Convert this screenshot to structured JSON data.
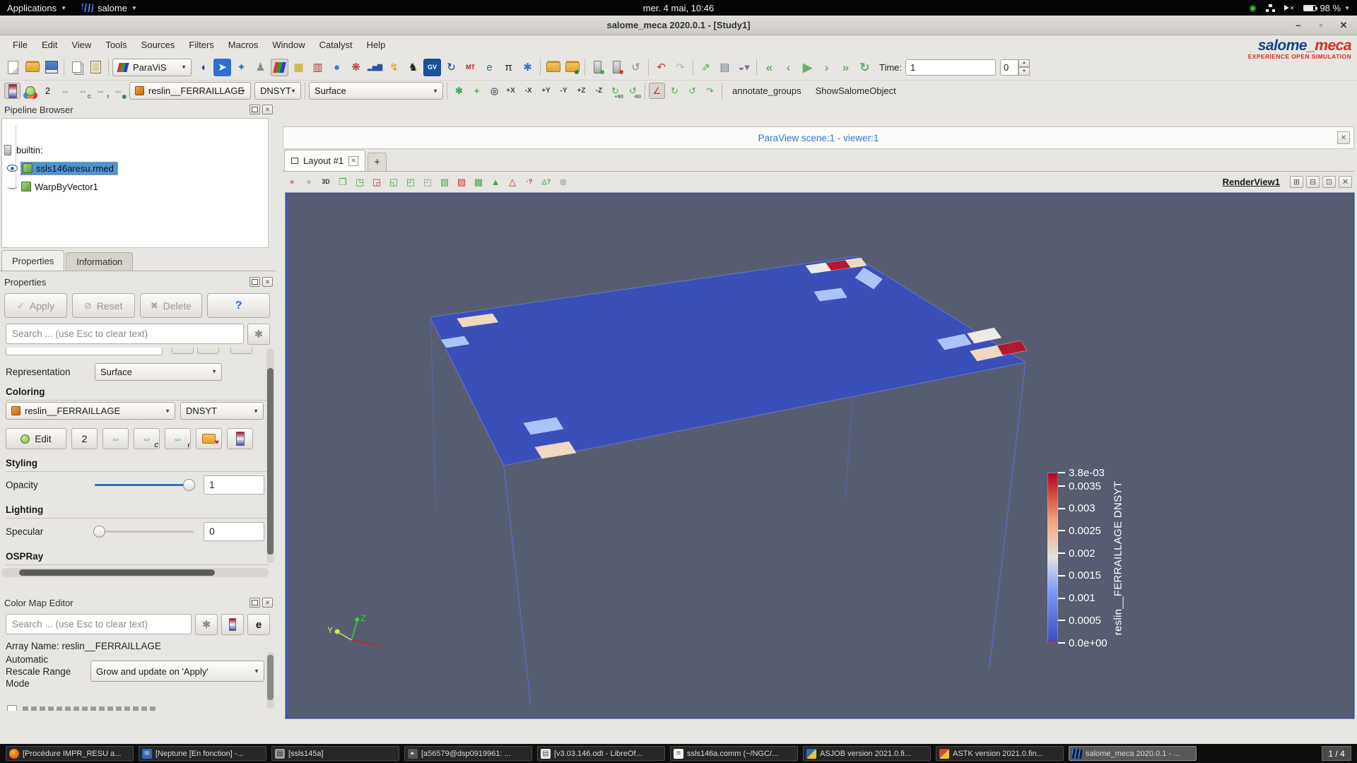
{
  "system_bar": {
    "applications_label": "Applications",
    "app_label": "salome",
    "clock": "mer.  4 mai, 10:46",
    "battery_label": "98 %"
  },
  "window": {
    "title": "salome_meca 2020.0.1 - [Study1]"
  },
  "menu_bar": {
    "items": [
      "File",
      "Edit",
      "View",
      "Tools",
      "Sources",
      "Filters",
      "Macros",
      "Window",
      "Catalyst",
      "Help"
    ]
  },
  "brand": {
    "title_blue": "salome",
    "title_red": "_meca",
    "tagline": "EXPERIENCE OPEN SIMULATION"
  },
  "toolbar1": {
    "module_selector": "ParaViS",
    "time_label": "Time:",
    "time_value": "1",
    "frame_value": "0",
    "file_icons": [
      {
        "name": "new-document-icon",
        "cls": "icp"
      },
      {
        "name": "open-file-icon",
        "cls": "icf"
      },
      {
        "name": "save-study-icon",
        "cls": "icfl"
      }
    ],
    "edit_icons": [
      {
        "name": "copy-icon",
        "cls": "iccp"
      },
      {
        "name": "paste-icon",
        "cls": "icpb"
      }
    ],
    "module_icons": [
      {
        "name": "shaper-module-icon",
        "glyph": "◖",
        "color": "#16418c"
      },
      {
        "name": "geometry-module-icon",
        "glyph": "➤",
        "color": "#ffffff",
        "bg": "#2f6fd0"
      },
      {
        "name": "mesh-module-icon",
        "glyph": "✦",
        "color": "#2a7ab5"
      },
      {
        "name": "smesh-tools-icon",
        "glyph": "♟",
        "color": "#8a8a8a"
      },
      {
        "name": "paravis-module-icon",
        "cls": "rgb",
        "pressed": true
      },
      {
        "name": "yacs-module-icon",
        "glyph": "▦",
        "color": "#c8a400"
      },
      {
        "name": "jobmanager-module-icon",
        "glyph": "▥",
        "color": "#b03030"
      },
      {
        "name": "med-module-icon",
        "glyph": "●",
        "color": "#3a7bd5"
      },
      {
        "name": "adao-module-icon",
        "glyph": "❋",
        "color": "#c02020"
      },
      {
        "name": "plot-module-icon",
        "glyph": "▂▅▇",
        "color": "#2255aa",
        "cls": "sm"
      },
      {
        "name": "ma-module-icon",
        "glyph": "↯",
        "color": "#d8a400"
      },
      {
        "name": "asterstudy-module-icon",
        "glyph": "♞",
        "color": "#222222"
      },
      {
        "name": "eficas-module-icon",
        "glyph": "GV",
        "cls": "sm",
        "color": "#ffffff",
        "bg": "#1a4f9c"
      },
      {
        "name": "curve-module-icon",
        "glyph": "↻",
        "color": "#16418c"
      },
      {
        "name": "mt-module-icon",
        "glyph": "MT",
        "cls": "sm",
        "color": "#c01818"
      },
      {
        "name": "europlexus-module-icon",
        "glyph": "e",
        "color": "#11808a"
      },
      {
        "name": "pi-module-icon",
        "glyph": "π",
        "color": "#222222"
      },
      {
        "name": "settings-gear-icon",
        "glyph": "✱",
        "color": "#3a6fd0"
      }
    ],
    "open_icons": [
      {
        "name": "open-data-file-icon",
        "cls": "icf"
      },
      {
        "name": "load-state-icon",
        "cls": "icf",
        "dot": "#2a8a2a"
      }
    ],
    "server_icons": [
      {
        "name": "connect-server-icon",
        "cls": "icsv",
        "dot": "#3fae3f"
      },
      {
        "name": "disconnect-server-icon",
        "cls": "icsv",
        "dot": "#d04040"
      },
      {
        "name": "reset-session-icon",
        "glyph": "↺",
        "color": "#8a8a8a"
      }
    ],
    "history_icons": [
      {
        "name": "undo-icon",
        "glyph": "↶",
        "color": "#c03a2b"
      },
      {
        "name": "redo-icon",
        "glyph": "↷",
        "color": "#b5b5b5"
      }
    ],
    "capture_icons": [
      {
        "name": "export-scene-icon",
        "glyph": "⇗",
        "color": "#3fae3f"
      },
      {
        "name": "capture-screenshot-icon",
        "glyph": "▤",
        "color": "#667788"
      },
      {
        "name": "color-palette-icon",
        "glyph": "◒▾",
        "color": "#8a6ab0"
      }
    ],
    "playback_icons": [
      {
        "name": "first-frame-icon",
        "glyph": "«",
        "color": "#6fae6f"
      },
      {
        "name": "previous-frame-icon",
        "glyph": "‹",
        "color": "#6fae6f"
      },
      {
        "name": "play-icon",
        "glyph": "▶",
        "color": "#6fae6f"
      },
      {
        "name": "next-frame-icon",
        "glyph": "›",
        "color": "#6fae6f"
      },
      {
        "name": "last-frame-icon",
        "glyph": "»",
        "color": "#6fae6f"
      },
      {
        "name": "loop-icon",
        "glyph": "↻",
        "color": "#6fae6f"
      }
    ]
  },
  "toolbar2": {
    "array_name": "reslin__FERRAILLAGE",
    "component": "DNSYT",
    "representation": "Surface",
    "left_icons": [
      {
        "name": "toggle-color-legend-icon",
        "cls": "iccm",
        "pressed": true
      },
      {
        "name": "edit-color-map-icon",
        "cls": "icbl"
      },
      {
        "name": "set-solid-color-icon",
        "glyph": "2",
        "color": "#111111"
      },
      {
        "name": "rescale-to-data-range-icon",
        "glyph": "⇔",
        "color": "#4aae4a"
      },
      {
        "name": "rescale-to-custom-range-icon",
        "glyph": "⇔",
        "sub": "C",
        "color": "#4aae4a"
      },
      {
        "name": "rescale-over-time-icon",
        "glyph": "⇔",
        "sub": "t",
        "color": "#4aae4a"
      },
      {
        "name": "rescale-to-visible-icon",
        "glyph": "⇔",
        "sub": "◉",
        "color": "#4aae4a"
      }
    ],
    "camera_icons": [
      {
        "name": "reset-camera-icon",
        "glyph": "✱",
        "color": "#4aae4a"
      },
      {
        "name": "zoom-to-data-icon",
        "glyph": "+",
        "color": "#4aae4a"
      },
      {
        "name": "zoom-to-box-icon",
        "glyph": "◎",
        "color": "#556677"
      }
    ],
    "view_buttons": [
      {
        "name": "view-plus-x-icon",
        "label": "+X"
      },
      {
        "name": "view-minus-x-icon",
        "label": "-X"
      },
      {
        "name": "view-plus-y-icon",
        "label": "+Y"
      },
      {
        "name": "view-minus-y-icon",
        "label": "-Y"
      },
      {
        "name": "view-plus-z-icon",
        "label": "+Z"
      },
      {
        "name": "view-minus-z-icon",
        "label": "-Z"
      }
    ],
    "rotate_buttons": [
      {
        "name": "rotate-90-cw-icon",
        "glyph": "↻",
        "sub": "+90",
        "color": "#4aae4a"
      },
      {
        "name": "rotate-90-ccw-icon",
        "glyph": "↺",
        "sub": "-90",
        "color": "#4aae4a"
      }
    ],
    "axes_icons": [
      {
        "name": "show-orientation-axes-icon",
        "glyph": "∠",
        "color": "#cc3333",
        "pressed": true
      },
      {
        "name": "rotate-view-cw-icon",
        "glyph": "↻",
        "color": "#4aae4a"
      },
      {
        "name": "rotate-view-ccw-icon",
        "glyph": "↺",
        "color": "#4aae4a"
      },
      {
        "name": "pick-rotation-center-icon",
        "glyph": "↷",
        "color": "#4aae4a"
      }
    ],
    "macros": [
      {
        "name": "macro-annotate-groups",
        "label": "annotate_groups"
      },
      {
        "name": "macro-show-salome-object",
        "label": "ShowSalomeObject"
      }
    ]
  },
  "pipeline": {
    "title": "Pipeline Browser",
    "items": [
      {
        "label": "builtin:"
      },
      {
        "label": "ssls146aresu.rmed"
      },
      {
        "label": "WarpByVector1"
      }
    ]
  },
  "properties_panel": {
    "tabs": [
      {
        "label": "Properties",
        "active": true
      },
      {
        "label": "Information"
      }
    ],
    "dock_title": "Properties",
    "apply_label": "Apply",
    "reset_label": "Reset",
    "delete_label": "Delete",
    "help_label": "?",
    "search_placeholder": "Search ... (use Esc to clear text)",
    "representation_label": "Representation",
    "representation_value": "Surface",
    "coloring_title": "Coloring",
    "coloring_array": "reslin__FERRAILLAGE",
    "coloring_component": "DNSYT",
    "edit_label": "Edit",
    "coloring_icons": [
      {
        "name": "edit-color-map-2-icon",
        "glyph": "2",
        "color": "#111111"
      },
      {
        "name": "rescale-to-data-range-icon",
        "glyph": "⇔",
        "color": "#4aae4a"
      },
      {
        "name": "rescale-to-custom-range-icon",
        "glyph": "⇔",
        "sub": "C",
        "color": "#4aae4a"
      },
      {
        "name": "rescale-over-time-icon",
        "glyph": "⇔",
        "sub": "t",
        "color": "#4aae4a"
      },
      {
        "name": "choose-preset-icon",
        "cls": "icfh"
      },
      {
        "name": "show-color-legend-icon",
        "cls": "iccm"
      }
    ],
    "styling_title": "Styling",
    "opacity_label": "Opacity",
    "opacity_value": "1",
    "lighting_title": "Lighting",
    "specular_label": "Specular",
    "specular_value": "0",
    "ospray_title": "OSPRay"
  },
  "color_map_editor": {
    "title": "Color Map Editor",
    "search_placeholder": "Search ... (use Esc to clear text)",
    "array_name": "Array Name: reslin__FERRAILLAGE",
    "rescale_mode_label": [
      "Automatic",
      "Rescale Range",
      "Mode"
    ],
    "rescale_mode_value": "Grow and update on 'Apply'"
  },
  "viewer": {
    "scene_title": "ParaView scene:1 - viewer:1",
    "layout_tab": "Layout #1",
    "view_label": "RenderView1",
    "axes": {
      "x": "x",
      "y": "Y",
      "z": "Z"
    },
    "toolbar_icons": [
      {
        "name": "edit-camera-icon",
        "glyph": "⌖",
        "color": "#c0392b"
      },
      {
        "name": "adjust-camera-icon",
        "glyph": "⌖",
        "color": "#999999"
      },
      {
        "name": "interaction-mode-3d-icon",
        "glyph": "3D",
        "cls": "sm",
        "color": "#333333"
      },
      {
        "name": "zoom-closest-icon",
        "glyph": "❒",
        "color": "#3fae3f"
      },
      {
        "name": "zoom-in-rect-icon",
        "glyph": "◳",
        "color": "#3fae3f"
      },
      {
        "name": "zoom-out-rect-icon",
        "glyph": "◲",
        "color": "#c0392b"
      },
      {
        "name": "zoom-box-icon",
        "glyph": "◱",
        "color": "#3fae3f"
      },
      {
        "name": "select-cells-rect-icon",
        "glyph": "◰",
        "color": "#3fae3f"
      },
      {
        "name": "select-points-rect-icon",
        "glyph": "◰",
        "color": "#999999"
      },
      {
        "name": "select-cells-polygon-icon",
        "glyph": "▧",
        "color": "#3fae3f"
      },
      {
        "name": "select-points-polygon-icon",
        "glyph": "▨",
        "color": "#c0392b"
      },
      {
        "name": "select-block-icon",
        "glyph": "▩",
        "color": "#3fae3f"
      },
      {
        "name": "interactive-select-cells-icon",
        "glyph": "▲",
        "color": "#3fae3f"
      },
      {
        "name": "interactive-select-points-icon",
        "glyph": "△",
        "color": "#c0392b"
      },
      {
        "name": "hover-points-icon",
        "glyph": "·?",
        "cls": "sm",
        "color": "#c0392b"
      },
      {
        "name": "hover-cells-icon",
        "glyph": "△?",
        "cls": "sm",
        "color": "#3fae3f"
      },
      {
        "name": "clear-selection-icon",
        "glyph": "⊗",
        "color": "#999999"
      }
    ]
  },
  "chart_data": {
    "type": "colorbar-legend",
    "title": "reslin__FERRAILLAGE DNSYT",
    "min": 0,
    "max": 0.0038,
    "tick_values": [
      0.0038,
      0.0035,
      0.003,
      0.0025,
      0.002,
      0.0015,
      0.001,
      0.0005,
      0
    ],
    "tick_labels": [
      "3.8e-03",
      "0.0035",
      "0.003",
      "0.0025",
      "0.002",
      "0.0015",
      "0.001",
      "0.0005",
      "0.0e+00"
    ],
    "colormap": "cool-warm",
    "colors": {
      "min": "#3b4cc0",
      "mid": "#f1f0ee",
      "max": "#b40426"
    }
  },
  "taskbar": {
    "items": [
      {
        "name": "task-firefox",
        "label": "[Procédure IMPR_RESU a...",
        "icon_bg": "radial-gradient(circle at 40% 35%, #ffb347, #e66000 70%)",
        "icon_radius": "50%"
      },
      {
        "name": "task-neptune",
        "label": "[Neptune [En fonction] -...",
        "icon_bg": "#2d6cb5",
        "glyph": "≋",
        "icon_color": "#cfe4ff"
      },
      {
        "name": "task-ssls145a",
        "label": "[ssls145a]",
        "icon_bg": "#9a9a9a",
        "glyph": "▤",
        "icon_color": "#333333"
      },
      {
        "name": "task-terminal",
        "label": "[a56579@dsp0919961: ...",
        "icon_bg": "#555555",
        "glyph": "▸",
        "icon_color": "#dddddd"
      },
      {
        "name": "task-libreoffice",
        "label": "[v3.03.146.odt - LibreOf...",
        "icon_bg": "#e8e8e6",
        "glyph": "▤",
        "icon_color": "#556677"
      },
      {
        "name": "task-editor",
        "label": "ssls146a.comm (~/NGC/...",
        "icon_bg": "#f5f5f3",
        "glyph": "≡",
        "icon_color": "#555555"
      },
      {
        "name": "task-asjob",
        "label": "ASJOB version 2021.0.fi...",
        "icon_bg": "linear-gradient(135deg,#2d6cb5 50%,#e8c23a 50%)"
      },
      {
        "name": "task-astk",
        "label": "ASTK version 2021.0.fin...",
        "icon_bg": "linear-gradient(135deg,#d04a3a 50%,#e8c23a 50%)"
      },
      {
        "name": "task-salome",
        "label": "salome_meca 2020.0.1 - ...",
        "icon_bg": "repeating-linear-gradient(100deg,#3a7bd5 0 2px,#0a1a3a 2px 5px)",
        "active": true
      }
    ],
    "workspace": "1 / 4"
  }
}
